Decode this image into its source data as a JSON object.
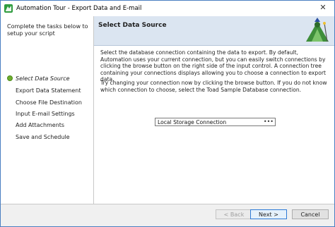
{
  "window": {
    "title": "Automation Tour - Export Data and E-mail",
    "close_glyph": "✕"
  },
  "left_panel": {
    "intro": "Complete the tasks below to setup your script",
    "steps": [
      {
        "label": "Select Data Source",
        "active": true
      },
      {
        "label": "Export Data Statement",
        "active": false
      },
      {
        "label": "Choose File Destination",
        "active": false
      },
      {
        "label": "Input E-mail Settings",
        "active": false
      },
      {
        "label": "Add Attachments",
        "active": false
      },
      {
        "label": "Save and Schedule",
        "active": false
      }
    ]
  },
  "header": {
    "title": "Select Data Source",
    "logo_icon": "toad-logo-icon"
  },
  "content": {
    "paragraph1": "Select the database connection containing the data to export. By default, Automation uses your current connection, but you can easily switch connections by clicking the browse button on the right side of the input control. A connection tree containing your connections displays allowing you to choose a connection to export data.",
    "paragraph2": "Try changing your connection now by clicking the browse button. If you do not know which connection to choose, select the Toad Sample Database connection.",
    "connection": {
      "value": "Local Storage Connection",
      "browse_label": "•••"
    }
  },
  "footer": {
    "back_label": "< Back",
    "next_label": "Next >",
    "cancel_label": "Cancel"
  },
  "colors": {
    "header_bg": "#dbe5f1",
    "active_step_dot": "#6fae2f",
    "window_border": "#4a7fc1"
  }
}
